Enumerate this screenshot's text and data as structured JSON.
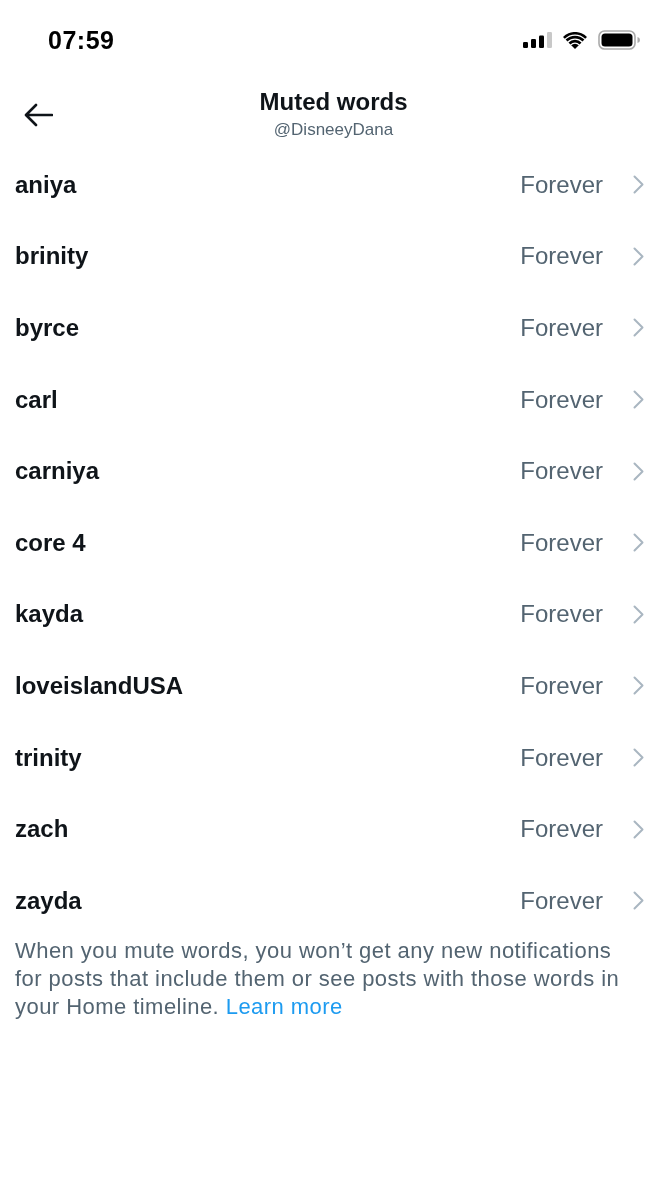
{
  "status_bar": {
    "time": "07:59"
  },
  "header": {
    "title": "Muted words",
    "subtitle": "@DisneeyDana"
  },
  "muted_words": [
    {
      "word": "aniya",
      "duration": "Forever"
    },
    {
      "word": "brinity",
      "duration": "Forever"
    },
    {
      "word": "byrce",
      "duration": "Forever"
    },
    {
      "word": "carl",
      "duration": "Forever"
    },
    {
      "word": "carniya",
      "duration": "Forever"
    },
    {
      "word": "core 4",
      "duration": "Forever"
    },
    {
      "word": "kayda",
      "duration": "Forever"
    },
    {
      "word": "loveislandUSA",
      "duration": "Forever"
    },
    {
      "word": "trinity",
      "duration": "Forever"
    },
    {
      "word": "zach",
      "duration": "Forever"
    },
    {
      "word": "zayda",
      "duration": "Forever"
    }
  ],
  "footer": {
    "text": "When you mute words, you won’t get any new notifications for posts that include them or see posts with those words in your Home timeline.",
    "link": "Learn more"
  }
}
